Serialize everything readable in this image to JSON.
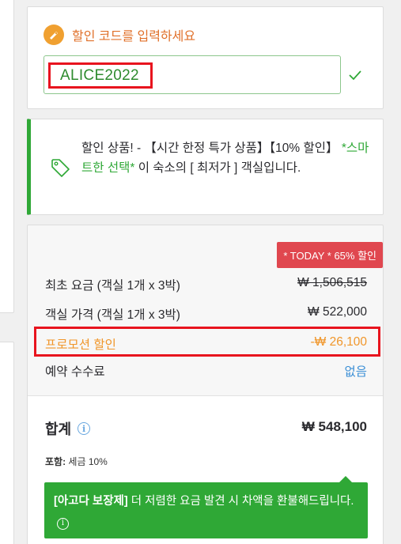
{
  "coupon": {
    "title": "할인 코드를 입력하세요",
    "code_value": "ALICE2022",
    "icon": "coupon-icon",
    "valid_icon": "check-icon"
  },
  "deal": {
    "icon": "tag-icon",
    "line_prefix": "할인 상품! - 【시간 한정 특가 상품】【10% 할인】",
    "highlight": "*스마트한 선택*",
    "line_suffix": " 이 숙소의 [ 최저가 ] 객실입니다."
  },
  "price": {
    "badge": "* TODAY * 65% 할인",
    "rows": [
      {
        "label": "최초 요금 (객실 1개 x 3박)",
        "value": "₩ 1,506,515"
      },
      {
        "label": "객실 가격 (객실 1개 x 3박)",
        "value": "₩ 522,000"
      },
      {
        "label": "프로모션 할인",
        "value": "-₩ 26,100"
      },
      {
        "label": "예약 수수료",
        "value": "없음"
      }
    ],
    "total_label": "합계",
    "total_value": "₩ 548,100",
    "tax_label": "포함:",
    "tax_value": " 세금 10%",
    "guarantee_bold": "[아고다 보장제]",
    "guarantee_text": " 더 저렴한 요금 발견 시 차액을 환불해드립니다."
  },
  "colors": {
    "accent_orange": "#e0702a",
    "green": "#2fa836",
    "badge_red": "#e0474f",
    "highlight_red": "#e8141e",
    "link_blue": "#3b8fd6"
  }
}
